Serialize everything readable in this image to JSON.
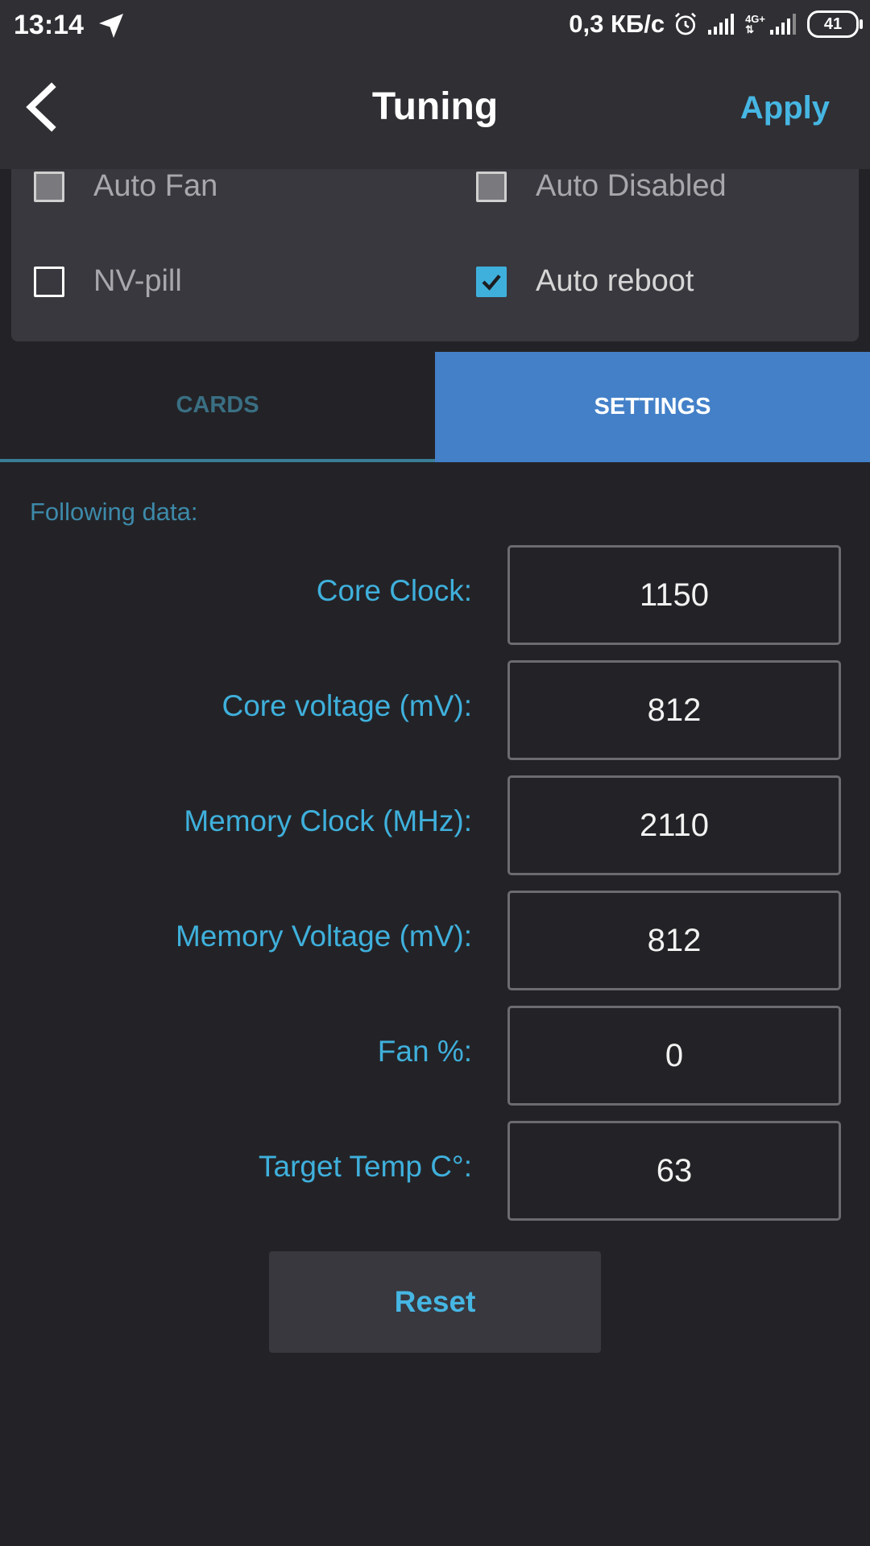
{
  "status_bar": {
    "time": "13:14",
    "speed": "0,3 КБ/с",
    "network": "4G+",
    "battery": "41"
  },
  "header": {
    "title": "Tuning",
    "apply_label": "Apply"
  },
  "options": [
    {
      "label": "Auto Fan",
      "state": "disabled"
    },
    {
      "label": "Auto Disabled",
      "state": "disabled"
    },
    {
      "label": "NV-pill",
      "state": "unchecked"
    },
    {
      "label": "Auto reboot",
      "state": "checked"
    }
  ],
  "tabs": [
    {
      "label": "CARDS",
      "active": false
    },
    {
      "label": "SETTINGS",
      "active": true
    }
  ],
  "settings": {
    "section_label": "Following data:",
    "fields": [
      {
        "label": "Core Clock:",
        "value": "1150"
      },
      {
        "label": "Core voltage (mV):",
        "value": "812"
      },
      {
        "label": "Memory Clock (MHz):",
        "value": "2110"
      },
      {
        "label": "Memory Voltage (mV):",
        "value": "812"
      },
      {
        "label": "Fan %:",
        "value": "0"
      },
      {
        "label": "Target Temp C°:",
        "value": "63"
      }
    ],
    "reset_label": "Reset"
  },
  "colors": {
    "background": "#232327",
    "header": "#2f2f34",
    "card": "#38383e",
    "accent": "#46b6e3",
    "tab_active": "#4380c8"
  }
}
